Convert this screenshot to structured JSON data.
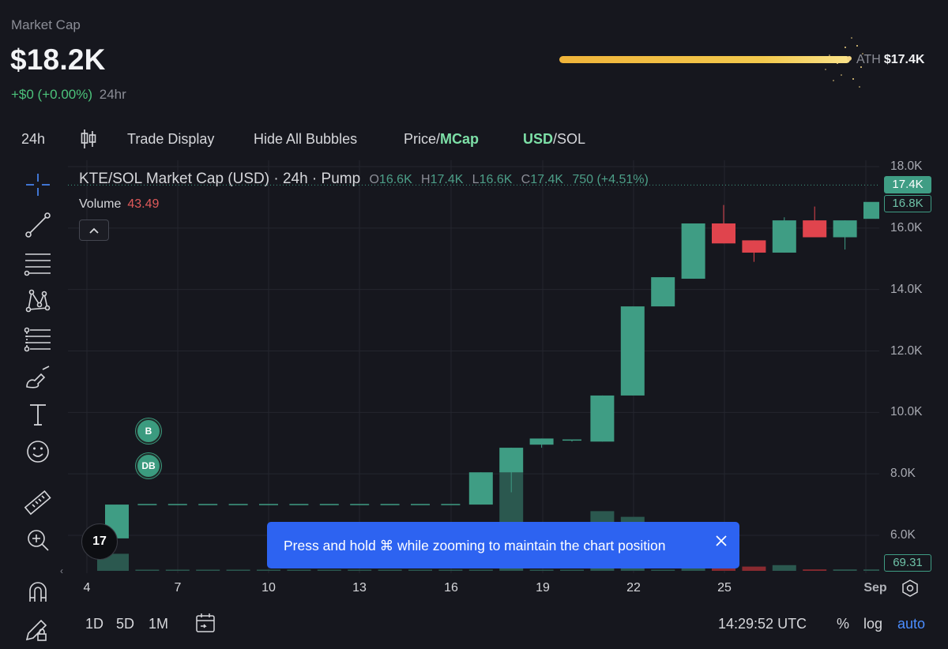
{
  "header": {
    "label": "Market Cap",
    "value": "$18.2K",
    "change": "+$0 (+0.00%)",
    "period": "24hr",
    "ath_label": "ATH",
    "ath_value": "$17.4K",
    "ath_progress": 1.0
  },
  "toolbar": {
    "interval": "24h",
    "trade_display": "Trade Display",
    "hide_bubbles": "Hide All Bubbles",
    "price_label": "Price/",
    "mcap_label": "MCap",
    "usd_label": "USD",
    "sol_label": "/SOL"
  },
  "legend": {
    "title": "KTE/SOL Market Cap (USD) · 24h · Pump",
    "o_label": "O",
    "o_value": "16.6K",
    "h_label": "H",
    "h_value": "17.4K",
    "l_label": "L",
    "l_value": "16.6K",
    "c_label": "C",
    "c_value": "17.4K",
    "change": "750 (+4.51%)",
    "volume_label": "Volume",
    "volume_value": "43.49",
    "collapse_icon": "chevron-up-icon"
  },
  "bubbles": [
    {
      "label": "B"
    },
    {
      "label": "DB"
    }
  ],
  "tv_logo": "17",
  "toast": {
    "text": "Press and hold ⌘ while zooming to maintain the chart position",
    "close_icon": "close-icon"
  },
  "date_axis": [
    "4",
    "7",
    "10",
    "13",
    "16",
    "19",
    "22",
    "25",
    "Sep"
  ],
  "price_axis": [
    "18.0K",
    "16.0K",
    "14.0K",
    "12.0K",
    "10.0K",
    "8.0K",
    "6.0K"
  ],
  "price_tags": {
    "last": "17.4K",
    "secondary": "16.8K",
    "volume": "69.31"
  },
  "colors": {
    "up": "#3f9d84",
    "down": "#e0444d",
    "accent": "#7de0a7",
    "toast": "#2d63f1"
  },
  "left_tools": [
    "crosshair-icon",
    "trend-line-icon",
    "horizontal-lines-icon",
    "pattern-icon",
    "fib-retracement-icon",
    "brush-icon",
    "text-tool-icon",
    "emoji-icon",
    "ruler-icon",
    "zoom-in-icon",
    "magnet-icon",
    "lock-drawing-icon"
  ],
  "bottom_bar": {
    "ranges": [
      "1D",
      "5D",
      "1M"
    ],
    "time": "14:29:52 UTC",
    "percent": "%",
    "log": "log",
    "auto": "auto"
  },
  "chart_data": {
    "type": "candlestick",
    "x_ticks": [
      "4",
      "7",
      "10",
      "13",
      "16",
      "19",
      "22",
      "25",
      "Sep"
    ],
    "ylim": [
      5400,
      18400
    ],
    "y_ticks": [
      6000,
      8000,
      10000,
      12000,
      14000,
      16000,
      18000
    ],
    "candles": [
      {
        "o": 5900,
        "h": 7000,
        "l": 5900,
        "c": 7000
      },
      {
        "o": 7000,
        "h": 7000,
        "l": 7000,
        "c": 7000
      },
      {
        "o": 7000,
        "h": 7000,
        "l": 7000,
        "c": 7000
      },
      {
        "o": 7000,
        "h": 7000,
        "l": 7000,
        "c": 7000
      },
      {
        "o": 7000,
        "h": 7000,
        "l": 7000,
        "c": 7000
      },
      {
        "o": 7000,
        "h": 7000,
        "l": 7000,
        "c": 7000
      },
      {
        "o": 7000,
        "h": 7000,
        "l": 7000,
        "c": 7000
      },
      {
        "o": 7000,
        "h": 7000,
        "l": 7000,
        "c": 7000
      },
      {
        "o": 7000,
        "h": 7000,
        "l": 7000,
        "c": 7000
      },
      {
        "o": 7000,
        "h": 7000,
        "l": 7000,
        "c": 7000
      },
      {
        "o": 7000,
        "h": 7000,
        "l": 7000,
        "c": 7000
      },
      {
        "o": 7000,
        "h": 7000,
        "l": 7000,
        "c": 7000
      },
      {
        "o": 7000,
        "h": 8050,
        "l": 7000,
        "c": 8050
      },
      {
        "o": 8050,
        "h": 8850,
        "l": 7400,
        "c": 8850
      },
      {
        "o": 8950,
        "h": 9150,
        "l": 8850,
        "c": 9150
      },
      {
        "o": 9050,
        "h": 9100,
        "l": 9050,
        "c": 9100
      },
      {
        "o": 9050,
        "h": 10550,
        "l": 9050,
        "c": 10550
      },
      {
        "o": 10550,
        "h": 13450,
        "l": 10550,
        "c": 13450
      },
      {
        "o": 13450,
        "h": 14400,
        "l": 13450,
        "c": 14400
      },
      {
        "o": 14350,
        "h": 16150,
        "l": 14350,
        "c": 16150
      },
      {
        "o": 16150,
        "h": 16750,
        "l": 15500,
        "c": 15500
      },
      {
        "o": 15600,
        "h": 15600,
        "l": 14900,
        "c": 15200
      },
      {
        "o": 15200,
        "h": 16350,
        "l": 15200,
        "c": 16250
      },
      {
        "o": 16250,
        "h": 16700,
        "l": 15700,
        "c": 15700
      },
      {
        "o": 15700,
        "h": 16250,
        "l": 15300,
        "c": 16250
      },
      {
        "o": 16300,
        "h": 16800,
        "l": 16300,
        "c": 16850
      }
    ],
    "volume": [
      12,
      0,
      0,
      0,
      0,
      0,
      0,
      0,
      0,
      0,
      0,
      0,
      0,
      70,
      0,
      0,
      42,
      38,
      0,
      34,
      3,
      3,
      4,
      1,
      1,
      1
    ],
    "volume_up": [
      true,
      true,
      true,
      true,
      true,
      true,
      true,
      true,
      true,
      true,
      true,
      true,
      true,
      true,
      true,
      true,
      true,
      true,
      true,
      true,
      false,
      false,
      true,
      false,
      true,
      true
    ]
  }
}
